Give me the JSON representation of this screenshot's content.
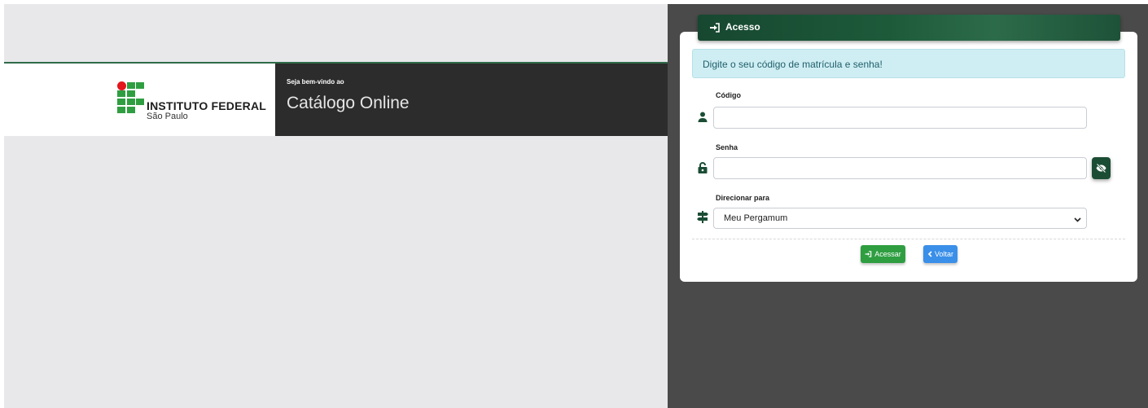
{
  "banner": {
    "logo_title": "INSTITUTO FEDERAL",
    "logo_subtitle": "São Paulo",
    "welcome": "Seja bem-vindo ao",
    "catalog_title": "Catálogo Online"
  },
  "login": {
    "header_title": "Acesso",
    "alert_text": "Digite o seu código de matrícula e senha!",
    "codigo_label": "Código",
    "codigo_value": "",
    "senha_label": "Senha",
    "senha_value": "",
    "direcionar_label": "Direcionar para",
    "direcionar_selected": "Meu Pergamum",
    "acessar_label": "Acessar",
    "voltar_label": "Voltar"
  },
  "icons": {
    "header": "sign-in-icon",
    "codigo": "user-icon",
    "senha": "unlock-icon",
    "eye": "eye-slash-icon",
    "direcionar": "signpost-icon",
    "select": "chevron-down-icon",
    "acessar": "sign-in-icon",
    "voltar": "chevron-left-icon"
  },
  "colors": {
    "brand_green": "#2f9e41",
    "brand_red": "#e3161b",
    "dark_green": "#1b4d34",
    "info_bg": "#cfeef3",
    "primary_blue": "#3a8fe8"
  }
}
